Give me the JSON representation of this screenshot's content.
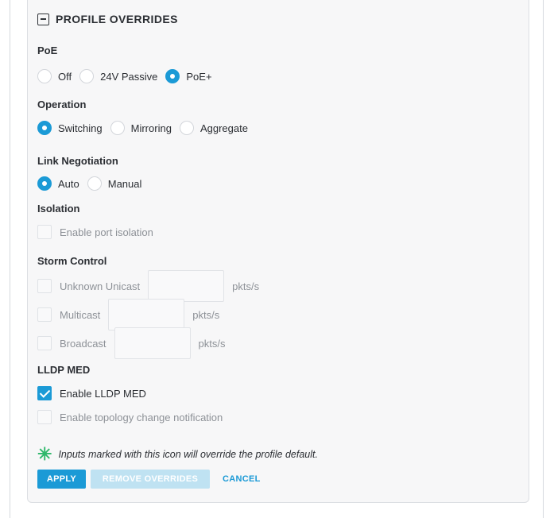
{
  "header": {
    "title": "PROFILE OVERRIDES",
    "collapse_icon": "minus-square-icon"
  },
  "poe": {
    "label": "PoE",
    "options": [
      "Off",
      "24V Passive",
      "PoE+"
    ],
    "selected": "PoE+"
  },
  "operation": {
    "label": "Operation",
    "options": [
      "Switching",
      "Mirroring",
      "Aggregate"
    ],
    "selected": "Switching"
  },
  "link_negotiation": {
    "label": "Link Negotiation",
    "options": [
      "Auto",
      "Manual"
    ],
    "selected": "Auto"
  },
  "isolation": {
    "label": "Isolation",
    "enable_label": "Enable port isolation",
    "checked": false
  },
  "storm_control": {
    "label": "Storm Control",
    "rows": [
      {
        "label": "Unknown Unicast",
        "value": "",
        "unit": "pkts/s",
        "checked": false
      },
      {
        "label": "Multicast",
        "value": "",
        "unit": "pkts/s",
        "checked": false
      },
      {
        "label": "Broadcast",
        "value": "",
        "unit": "pkts/s",
        "checked": false
      }
    ]
  },
  "lldp_med": {
    "label": "LLDP MED",
    "enable_label": "Enable LLDP MED",
    "enable_checked": true,
    "topology_label": "Enable topology change notification",
    "topology_checked": false
  },
  "note": {
    "icon": "asterisk-icon",
    "text": "Inputs marked with this icon will override the profile default."
  },
  "buttons": {
    "apply": "APPLY",
    "remove": "REMOVE OVERRIDES",
    "cancel": "CANCEL"
  },
  "colors": {
    "accent": "#1b9ad6",
    "accent_disabled": "#bfe2f2",
    "override_star": "#2fb86b"
  }
}
